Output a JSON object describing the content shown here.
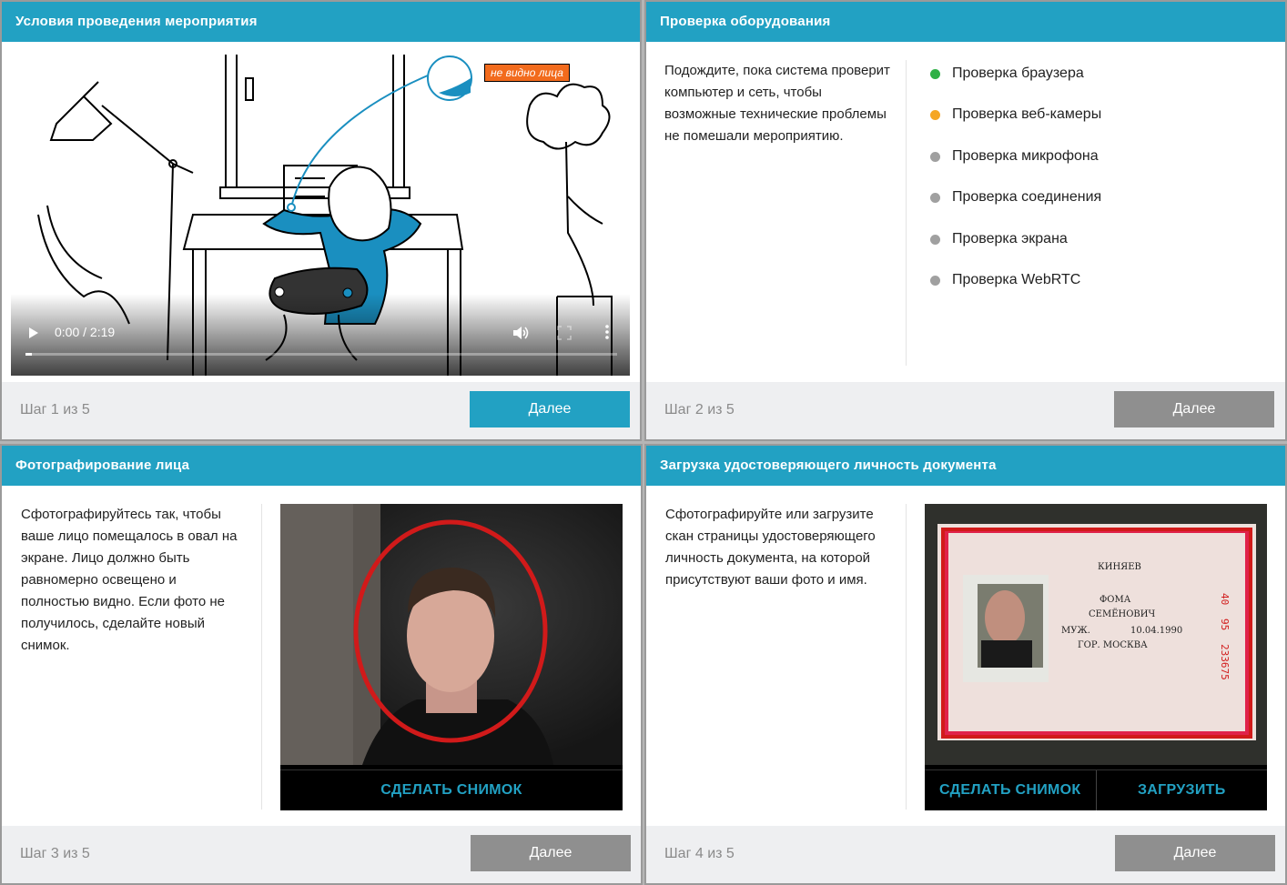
{
  "panels": {
    "conditions": {
      "title": "Условия проведения мероприятия",
      "video": {
        "time": "0:00 / 2:19",
        "progress": 0.01,
        "badge": "не видно лица"
      },
      "step": "Шаг 1 из 5",
      "next_label": "Далее"
    },
    "equipment": {
      "title": "Проверка оборудования",
      "description": "Подождите, пока система проверит компьютер и сеть, чтобы возможные технические проблемы не помешали мероприятию.",
      "checks": [
        {
          "label": "Проверка браузера",
          "status_color": "#2fb046"
        },
        {
          "label": "Проверка веб-камеры",
          "status_color": "#f5a623"
        },
        {
          "label": "Проверка микрофона",
          "status_color": "#a0a0a0"
        },
        {
          "label": "Проверка соединения",
          "status_color": "#a0a0a0"
        },
        {
          "label": "Проверка экрана",
          "status_color": "#a0a0a0"
        },
        {
          "label": "Проверка WebRTC",
          "status_color": "#a0a0a0"
        }
      ],
      "step": "Шаг 2 из 5",
      "next_label": "Далее"
    },
    "face_photo": {
      "title": "Фотографирование лица",
      "description": "Сфотографируйтесь так, чтобы ваше лицо помещалось в овал на экране. Лицо должно быть равномерно освещено и полностью видно. Если фото не получилось, сделайте новый снимок.",
      "snapshot_label": "СДЕЛАТЬ СНИМОК",
      "step": "Шаг 3 из 5",
      "next_label": "Далее"
    },
    "document": {
      "title": "Загрузка удостоверяющего личность документа",
      "description": "Сфотографируйте или загрузите скан страницы удостоверяющего личность документа, на которой присутствуют ваши фото и имя.",
      "snapshot_label": "СДЕЛАТЬ СНИМОК",
      "upload_label": "ЗАГРУЗИТЬ",
      "passport": {
        "surname": "КИНЯЕВ",
        "name": "ФОМА",
        "patronymic": "СЕМЁНОВИЧ",
        "sex": "МУЖ.",
        "birth_date": "10.04.1990",
        "birth_place": "ГОР. МОСКВА",
        "series_1": "40",
        "series_2": "95",
        "number": "233675"
      },
      "step": "Шаг 4 из 5",
      "next_label": "Далее"
    }
  },
  "colors": {
    "accent": "#22a1c3",
    "disabled": "#8f8f8f",
    "oval": "#d11a1a",
    "badge": "#f26b1d"
  }
}
